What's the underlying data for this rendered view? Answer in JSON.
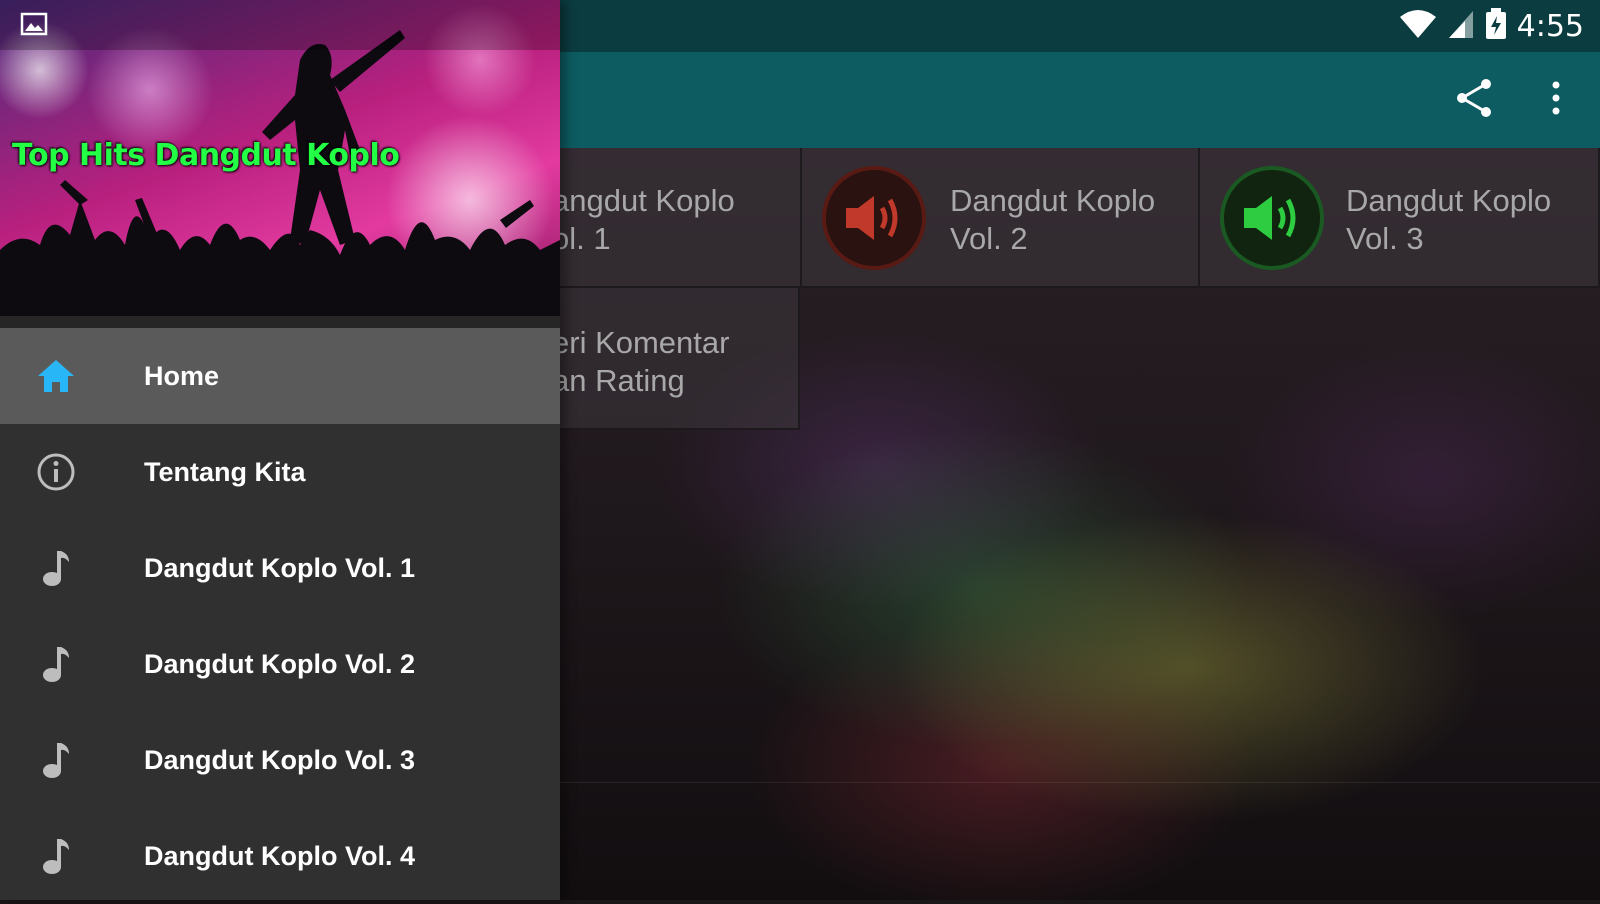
{
  "status_bar": {
    "time": "4:55"
  },
  "app_bar": {
    "share_icon": "share-icon",
    "overflow_icon": "more-vert-icon"
  },
  "tiles": [
    {
      "label": "angdut Koplo\nol. 1",
      "icon": "speaker-icon"
    },
    {
      "label": "Dangdut Koplo\nVol. 2",
      "icon": "speaker-icon",
      "color": "#c0392b"
    },
    {
      "label": "Dangdut Koplo\nVol. 3",
      "icon": "speaker-icon",
      "color": "#2ecc40"
    },
    {
      "label": "eri Komentar\nan Rating"
    }
  ],
  "drawer": {
    "header_title": "Top Hits Dangdut Koplo",
    "title_color": "#22ff44",
    "items": [
      {
        "label": "Home",
        "icon": "home-icon",
        "active": true,
        "icon_color": "#29b6f6"
      },
      {
        "label": "Tentang Kita",
        "icon": "info-icon"
      },
      {
        "label": "Dangdut Koplo Vol. 1",
        "icon": "music-note-icon"
      },
      {
        "label": "Dangdut Koplo Vol. 2",
        "icon": "music-note-icon"
      },
      {
        "label": "Dangdut Koplo Vol. 3",
        "icon": "music-note-icon"
      },
      {
        "label": "Dangdut Koplo Vol. 4",
        "icon": "music-note-icon"
      }
    ]
  }
}
